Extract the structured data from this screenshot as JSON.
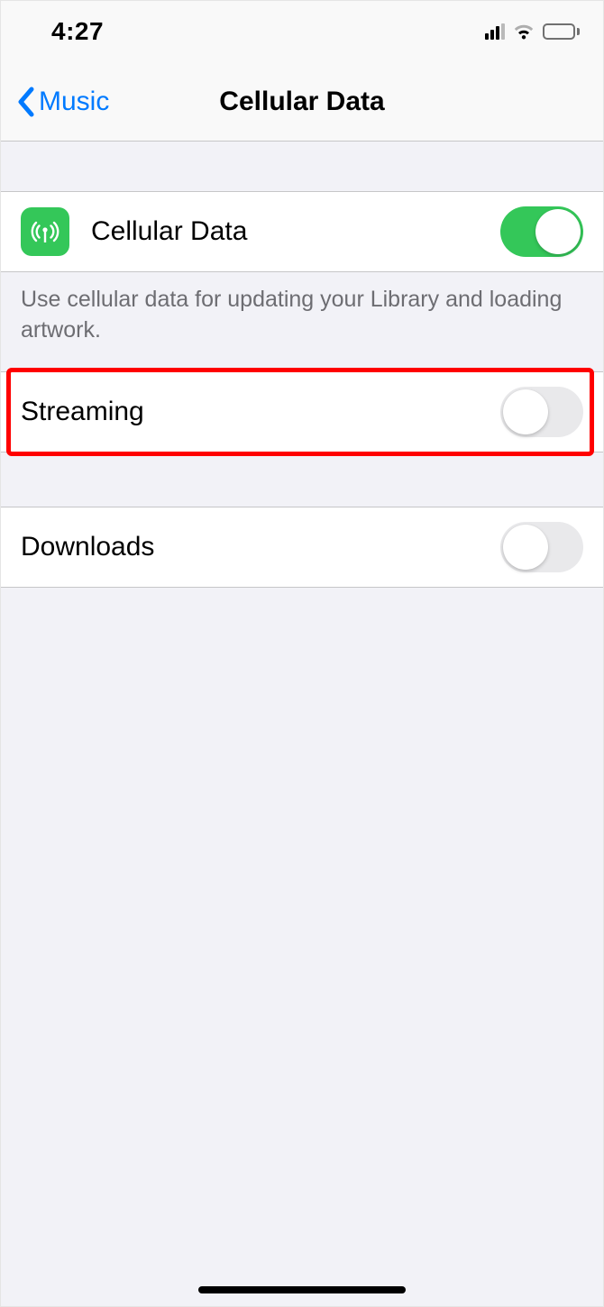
{
  "status_bar": {
    "time": "4:27"
  },
  "nav": {
    "back_label": "Music",
    "title": "Cellular Data"
  },
  "rows": {
    "cellular_data": {
      "label": "Cellular Data",
      "on": true
    },
    "streaming": {
      "label": "Streaming",
      "on": false
    },
    "downloads": {
      "label": "Downloads",
      "on": false
    }
  },
  "footer": {
    "cellular_data": "Use cellular data for updating your Library and loading artwork."
  }
}
